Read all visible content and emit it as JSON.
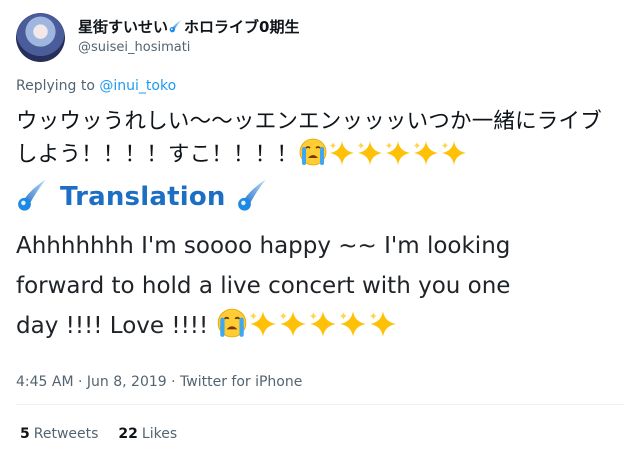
{
  "author": {
    "display_name": "星街すいせい",
    "display_name_suffix": "ホロライブ0期生",
    "handle": "@suisei_hosimati"
  },
  "reply": {
    "prefix": "Replying to",
    "to": "@inui_toko"
  },
  "tweet": {
    "jp_line1": "ウッウッうれしい〜〜ッエンエンッッッいつか一緒にライブ",
    "jp_line2": "しよう！！！！すこ！！！！",
    "translation_label": "Translation",
    "en_line1": "Ahhhhhhh I'm soooo happy ~~ I'm looking",
    "en_line2": "forward to hold a live concert with you one",
    "en_line3": "day !!!! Love !!!!"
  },
  "meta": {
    "time": "4:45 AM",
    "sep1": " · ",
    "date": "Jun 8, 2019",
    "sep2": " · ",
    "client": "Twitter for iPhone"
  },
  "stats": {
    "retweets_count": "5",
    "retweets_label": "Retweets",
    "likes_count": "22",
    "likes_label": "Likes"
  },
  "colors": {
    "link": "#1d9bf0",
    "translation": "#1d6fc3",
    "secondary": "#536471"
  },
  "icons": [
    "comet-icon",
    "crying-face-emoji",
    "sparkles-emoji"
  ]
}
